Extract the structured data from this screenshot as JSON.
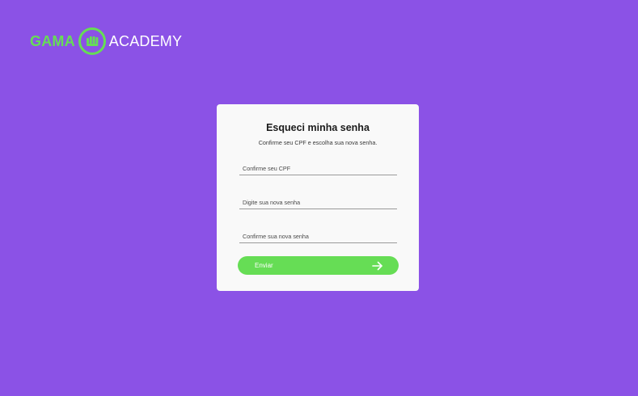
{
  "logo": {
    "word_left": "GAMA",
    "word_right": "ACADEMY",
    "mark_icon": "fist-in-circle-icon"
  },
  "form": {
    "title": "Esqueci minha senha",
    "subtitle": "Confirme seu CPF e escolha sua nova senha.",
    "cpf_placeholder": "Confirme seu CPF",
    "new_password_placeholder": "Digite sua nova senha",
    "confirm_password_placeholder": "Confirme sua nova senha",
    "submit_label": "Enviar",
    "submit_icon": "arrow-right-icon"
  },
  "colors": {
    "background": "#8b52e6",
    "accent": "#66dd55",
    "card": "#f9f9f9"
  }
}
